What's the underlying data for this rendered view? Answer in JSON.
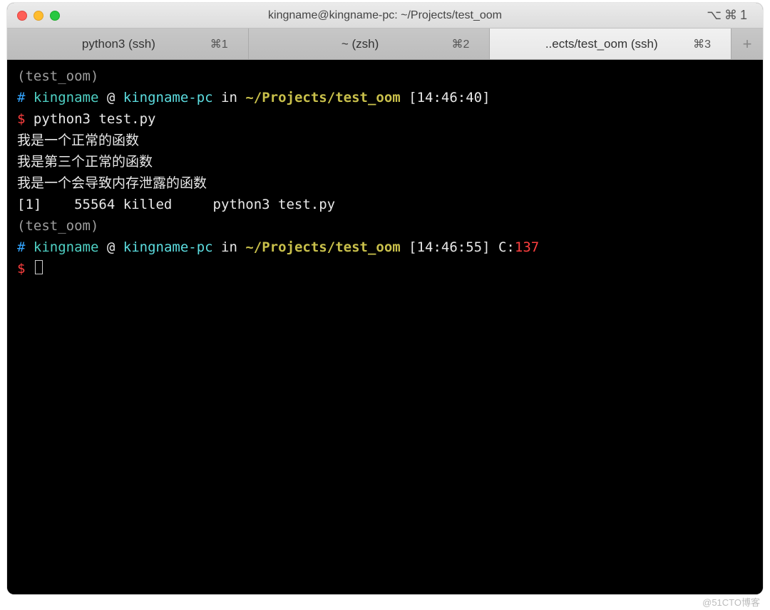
{
  "window": {
    "title": "kingname@kingname-pc: ~/Projects/test_oom",
    "right_badge": "⌥⌘1"
  },
  "tabs": [
    {
      "label": "python3 (ssh)",
      "shortcut": "⌘1",
      "active": false
    },
    {
      "label": "~ (zsh)",
      "shortcut": "⌘2",
      "active": false
    },
    {
      "label": "..ects/test_oom (ssh)",
      "shortcut": "⌘3",
      "active": true
    }
  ],
  "add_tab_glyph": "+",
  "terminal": {
    "env1": "(test_oom)",
    "hash1": "#",
    "user1": "kingname",
    "at1": " @ ",
    "host1": "kingname-pc",
    "in1": " in ",
    "path1": "~/Projects/test_oom",
    "time1": " [14:46:40]",
    "dollar1": "$ ",
    "cmd1": "python3 test.py",
    "out1": "我是一个正常的函数",
    "out2": "我是第三个正常的函数",
    "out3": "我是一个会导致内存泄露的函数",
    "out4": "[1]    55564 killed     python3 test.py",
    "env2": "(test_oom)",
    "hash2": "#",
    "user2": "kingname",
    "at2": " @ ",
    "host2": "kingname-pc",
    "in2": " in ",
    "path2": "~/Projects/test_oom",
    "time2": " [14:46:55] ",
    "clabel": "C:",
    "ccode": "137",
    "dollar2": "$ "
  },
  "watermark": "@51CTO博客"
}
